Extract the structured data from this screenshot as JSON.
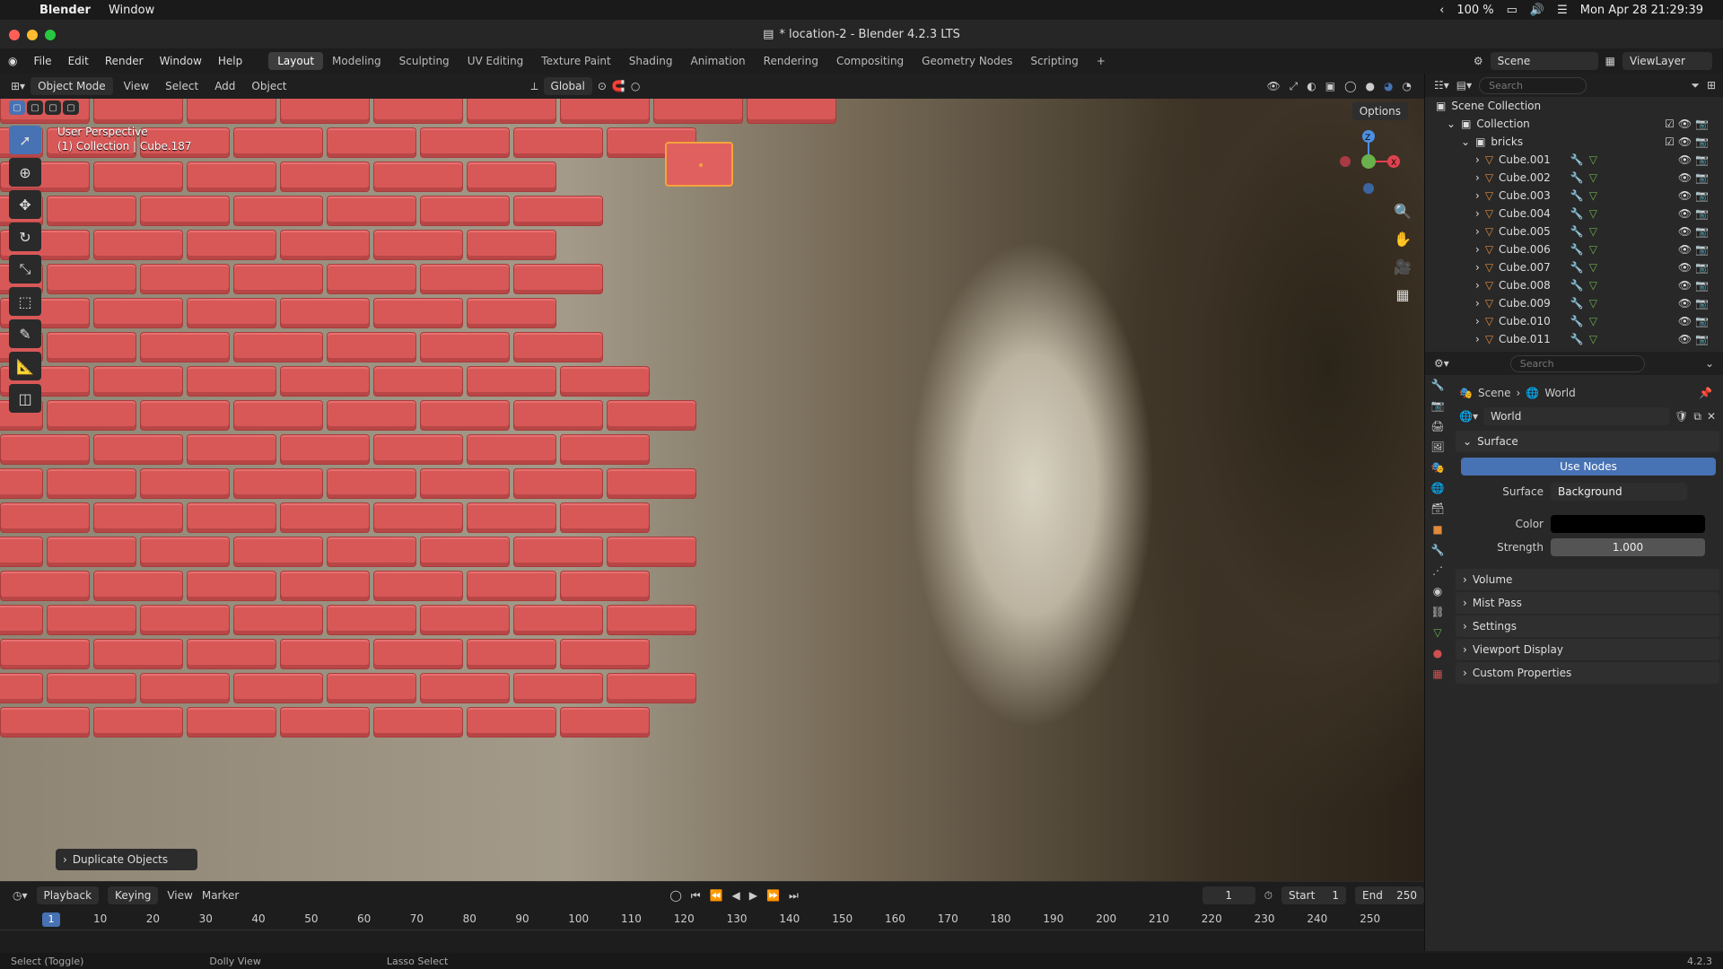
{
  "macbar": {
    "app": "Blender",
    "menu": "Window",
    "battery": "100 %",
    "datetime": "Mon Apr 28  21:29:39"
  },
  "window_title": "* location-2 - Blender 4.2.3 LTS",
  "menus": [
    "File",
    "Edit",
    "Render",
    "Window",
    "Help"
  ],
  "workspaces": [
    "Layout",
    "Modeling",
    "Sculpting",
    "UV Editing",
    "Texture Paint",
    "Shading",
    "Animation",
    "Rendering",
    "Compositing",
    "Geometry Nodes",
    "Scripting",
    "+"
  ],
  "active_workspace": "Layout",
  "scene": "Scene",
  "viewlayer": "ViewLayer",
  "viewport_header": {
    "mode": "Object Mode",
    "view": "View",
    "select": "Select",
    "add": "Add",
    "object": "Object",
    "orientation": "Global",
    "options": "Options"
  },
  "viewport": {
    "perspective": "User Perspective",
    "info": "(1) Collection | Cube.187",
    "last_op": "Duplicate Objects"
  },
  "outliner": {
    "search_placeholder": "Search",
    "scene_collection": "Scene Collection",
    "collection": "Collection",
    "group": "bricks",
    "items": [
      "Cube.001",
      "Cube.002",
      "Cube.003",
      "Cube.004",
      "Cube.005",
      "Cube.006",
      "Cube.007",
      "Cube.008",
      "Cube.009",
      "Cube.010",
      "Cube.011"
    ]
  },
  "properties": {
    "search_placeholder": "Search",
    "breadcrumb_scene": "Scene",
    "breadcrumb_world": "World",
    "world_name": "World",
    "surface_header": "Surface",
    "use_nodes": "Use Nodes",
    "surface_label": "Surface",
    "surface_value": "Background",
    "color_label": "Color",
    "strength_label": "Strength",
    "strength_value": "1.000",
    "sections": [
      "Volume",
      "Mist Pass",
      "Settings",
      "Viewport Display",
      "Custom Properties"
    ]
  },
  "timeline": {
    "playback": "Playback",
    "keying": "Keying",
    "view": "View",
    "marker": "Marker",
    "current": "1",
    "start_label": "Start",
    "start": "1",
    "end_label": "End",
    "end": "250",
    "ticks": [
      "10",
      "20",
      "30",
      "40",
      "50",
      "60",
      "70",
      "80",
      "90",
      "100",
      "110",
      "120",
      "130",
      "140",
      "150",
      "160",
      "170",
      "180",
      "190",
      "200",
      "210",
      "220",
      "230",
      "240",
      "250"
    ],
    "cur_frame": "1"
  },
  "status": {
    "select": "Select (Toggle)",
    "dolly": "Dolly View",
    "lasso": "Lasso Select",
    "version": "4.2.3"
  },
  "colors": {
    "accent": "#4772b3",
    "brick": "#d85858",
    "selection": "#f5a33b"
  }
}
